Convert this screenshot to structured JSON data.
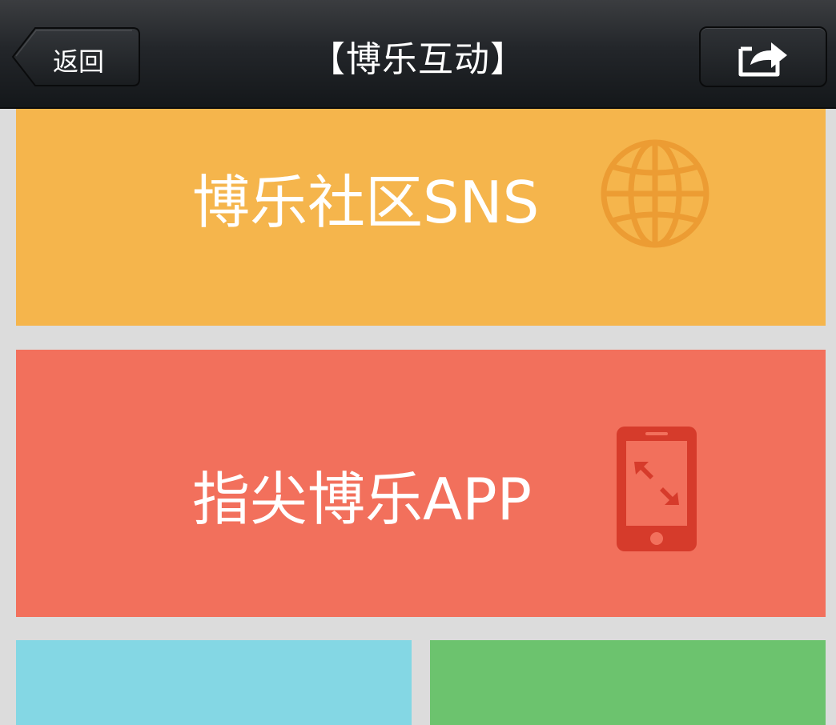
{
  "header": {
    "title": "【博乐互动】",
    "back_label": "返回",
    "share_icon": "share-icon"
  },
  "tiles": [
    {
      "label": "博乐社区SNS",
      "icon": "globe-icon",
      "color": "#f5b54c"
    },
    {
      "label": "指尖博乐APP",
      "icon": "mobile-phone-icon",
      "color": "#f2705c"
    },
    {
      "label": "",
      "icon": "",
      "color": "#84d7e4"
    },
    {
      "label": "",
      "icon": "",
      "color": "#6cc36e"
    }
  ],
  "colors": {
    "navbar": "#1c1f22",
    "background": "#dcdcdc"
  }
}
